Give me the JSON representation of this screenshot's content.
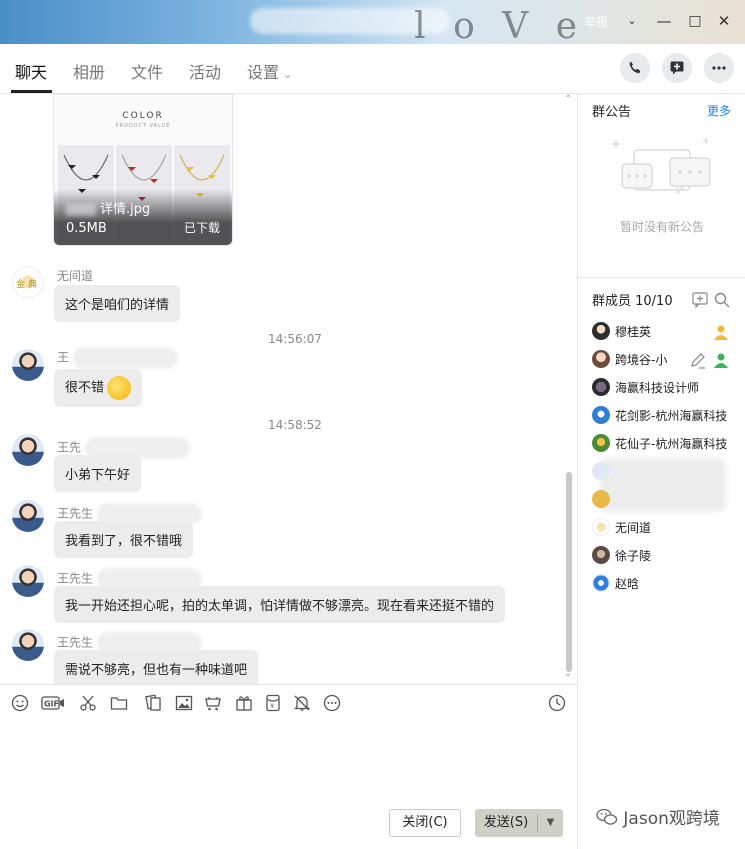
{
  "titlebar": {
    "report": "举报",
    "deco_text": "l o V e"
  },
  "tabs": [
    {
      "label": "聊天"
    },
    {
      "label": "相册"
    },
    {
      "label": "文件"
    },
    {
      "label": "活动"
    },
    {
      "label": "设置"
    }
  ],
  "file": {
    "name_visible": "详情.jpg",
    "size": "0.5MB",
    "status": "已下载",
    "thumb_title": "COLOR",
    "thumb_sub": "PRODUCT VALUE"
  },
  "messages": [
    {
      "sender": "无间道",
      "text": "这个是咱们的详情"
    },
    {
      "time": "14:56:07"
    },
    {
      "sender": "王",
      "text": "很不错"
    },
    {
      "time": "14:58:52"
    },
    {
      "sender": "王先",
      "text": "小弟下午好"
    },
    {
      "sender": "王先生",
      "text": "我看到了，很不错哦"
    },
    {
      "sender": "王先生",
      "text": "我一开始还担心呢，拍的太单调，怕详情做不够漂亮。现在看来还挺不错的"
    },
    {
      "sender": "王先生",
      "text": "需说不够亮，但也有一种味道吧"
    }
  ],
  "buttons": {
    "close": "关闭(C)",
    "send": "发送(S)"
  },
  "notice": {
    "title": "群公告",
    "more": "更多",
    "empty": "暂时没有新公告"
  },
  "members": {
    "title": "群成员 10/10",
    "list": [
      {
        "name": "穆桂英"
      },
      {
        "name": "跨境谷-小"
      },
      {
        "name": "海赢科技设计师"
      },
      {
        "name": "花剑影-杭州海赢科技"
      },
      {
        "name": "花仙子-杭州海赢科技"
      },
      {
        "name": "无间道"
      },
      {
        "name": "徐子陵"
      },
      {
        "name": "赵晗"
      }
    ]
  },
  "watermark": "Jason观跨境",
  "colors": {
    "accent": "#1e88e5",
    "bubble": "#ececec",
    "send_button": "#cfd0c8"
  }
}
